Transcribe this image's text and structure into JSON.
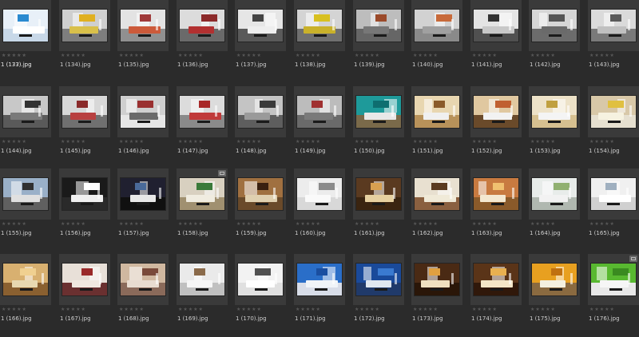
{
  "browser": {
    "rating_glyph": "★★★★★",
    "items": [
      {
        "filename": "1 (133).jpg",
        "palette": {
          "wall": "#d9d9d9",
          "floor": "#8a8a8a",
          "accent": "#4a4a4a",
          "sofa": "#5c5c5c"
        }
      },
      {
        "filename": "1 (134).jpg",
        "palette": {
          "wall": "#cfcfcf",
          "floor": "#7e7e7e",
          "accent": "#e0b020",
          "sofa": "#d9c04a"
        }
      },
      {
        "filename": "1 (135).jpg",
        "palette": {
          "wall": "#e3e3e3",
          "floor": "#909090",
          "accent": "#a03a3a",
          "sofa": "#cc5a3a"
        }
      },
      {
        "filename": "1 (136).jpg",
        "palette": {
          "wall": "#dcdcdc",
          "floor": "#6a6a6a",
          "accent": "#8c2a2a",
          "sofa": "#b23030"
        }
      },
      {
        "filename": "1 (137).jpg",
        "palette": {
          "wall": "#e6e6e6",
          "floor": "#5a5a5a",
          "accent": "#444444",
          "sofa": "#eeeeee"
        }
      },
      {
        "filename": "1 (138).jpg",
        "palette": {
          "wall": "#d4d4d4",
          "floor": "#707070",
          "accent": "#d8c020",
          "sofa": "#c9b12a"
        }
      },
      {
        "filename": "1 (139).jpg",
        "palette": {
          "wall": "#bdbdbd",
          "floor": "#666666",
          "accent": "#9b4a2a",
          "sofa": "#777777"
        }
      },
      {
        "filename": "1 (140).jpg",
        "palette": {
          "wall": "#d2d2d2",
          "floor": "#8a8a8a",
          "accent": "#c86a3a",
          "sofa": "#a0a0a0"
        }
      },
      {
        "filename": "1 (141).jpg",
        "palette": {
          "wall": "#e4e4e4",
          "floor": "#505050",
          "accent": "#333333",
          "sofa": "#c8c8c8"
        }
      },
      {
        "filename": "1 (142).jpg",
        "palette": {
          "wall": "#d6d6d6",
          "floor": "#6c6c6c",
          "accent": "#555555",
          "sofa": "#6a6a6a"
        }
      },
      {
        "filename": "1 (143).jpg",
        "palette": {
          "wall": "#dadada",
          "floor": "#7a7a7a",
          "accent": "#5a5a5a",
          "sofa": "#c0c0c0"
        }
      },
      {
        "filename": "1 (144).jpg",
        "palette": {
          "wall": "#c8c8c8",
          "floor": "#5a5a5a",
          "accent": "#333333",
          "sofa": "#7a7a7a"
        }
      },
      {
        "filename": "1 (145).jpg",
        "palette": {
          "wall": "#d8d8d8",
          "floor": "#707070",
          "accent": "#8a2a2a",
          "sofa": "#b84040"
        }
      },
      {
        "filename": "1 (146).jpg",
        "palette": {
          "wall": "#cfcfcf",
          "floor": "#e6e6e6",
          "accent": "#9a3030",
          "sofa": "#6a6a6a"
        }
      },
      {
        "filename": "1 (147).jpg",
        "palette": {
          "wall": "#dcdcdc",
          "floor": "#8a8a8a",
          "accent": "#a82828",
          "sofa": "#c03a3a"
        }
      },
      {
        "filename": "1 (148).jpg",
        "palette": {
          "wall": "#c4c4c4",
          "floor": "#5e5e5e",
          "accent": "#3a3a3a",
          "sofa": "#9a9a9a"
        }
      },
      {
        "filename": "1 (149).jpg",
        "palette": {
          "wall": "#bcbcbc",
          "floor": "#6a6a6a",
          "accent": "#a03030",
          "sofa": "#7a7a7a"
        }
      },
      {
        "filename": "1 (150).jpg",
        "palette": {
          "wall": "#1e9a9a",
          "floor": "#7a6a4a",
          "accent": "#0e6e70",
          "sofa": "#e8e8e8"
        }
      },
      {
        "filename": "1 (151).jpg",
        "palette": {
          "wall": "#e8d6b0",
          "floor": "#b8925a",
          "accent": "#8a5a2a",
          "sofa": "#f0f0f0"
        }
      },
      {
        "filename": "1 (152).jpg",
        "palette": {
          "wall": "#e0c8a0",
          "floor": "#6a4a2a",
          "accent": "#c06030",
          "sofa": "#f2f2f2"
        }
      },
      {
        "filename": "1 (153).jpg",
        "palette": {
          "wall": "#ede2c8",
          "floor": "#d6c090",
          "accent": "#c0a040",
          "sofa": "#f4f4f4"
        }
      },
      {
        "filename": "1 (154).jpg",
        "palette": {
          "wall": "#d8c8a8",
          "floor": "#e6e0d0",
          "accent": "#e0c040",
          "sofa": "#f6f2e0"
        }
      },
      {
        "filename": "1 (155).jpg",
        "palette": {
          "wall": "#9ab0c8",
          "floor": "#606060",
          "accent": "#303030",
          "sofa": "#e0e0e0"
        }
      },
      {
        "filename": "1 (156).jpg",
        "palette": {
          "wall": "#1a1a1a",
          "floor": "#2a2a2a",
          "accent": "#ffffff",
          "sofa": "#f0f0f0"
        }
      },
      {
        "filename": "1 (157).jpg",
        "palette": {
          "wall": "#202030",
          "floor": "#101010",
          "accent": "#4a6a9a",
          "sofa": "#e8e8e8"
        }
      },
      {
        "filename": "1 (158).jpg",
        "palette": {
          "wall": "#d8d0c0",
          "floor": "#a09070",
          "accent": "#3a7a3a",
          "sofa": "#f0ece0"
        }
      },
      {
        "filename": "1 (159).jpg",
        "palette": {
          "wall": "#a07040",
          "floor": "#6a4a2a",
          "accent": "#3a2010",
          "sofa": "#e0d0b0"
        }
      },
      {
        "filename": "1 (160).jpg",
        "palette": {
          "wall": "#ececec",
          "floor": "#d8d8d8",
          "accent": "#8a8a8a",
          "sofa": "#fafafa"
        }
      },
      {
        "filename": "1 (161).jpg",
        "palette": {
          "wall": "#5a3a20",
          "floor": "#3a2410",
          "accent": "#d8a050",
          "sofa": "#e6d0a0"
        }
      },
      {
        "filename": "1 (162).jpg",
        "palette": {
          "wall": "#e8e0d0",
          "floor": "#8a6040",
          "accent": "#5a3a20",
          "sofa": "#f0ead8"
        }
      },
      {
        "filename": "1 (163).jpg",
        "palette": {
          "wall": "#c87a40",
          "floor": "#8a5a2a",
          "accent": "#f0c070",
          "sofa": "#f4e8d0"
        }
      },
      {
        "filename": "1 (164).jpg",
        "palette": {
          "wall": "#e8ecea",
          "floor": "#b0b8b0",
          "accent": "#90b070",
          "sofa": "#f2f2f2"
        }
      },
      {
        "filename": "1 (165).jpg",
        "palette": {
          "wall": "#f0f0f0",
          "floor": "#d0d0d0",
          "accent": "#a0b0c0",
          "sofa": "#ffffff"
        }
      },
      {
        "filename": "1 (166).jpg",
        "palette": {
          "wall": "#d8b070",
          "floor": "#8a6030",
          "accent": "#f0d090",
          "sofa": "#e8d8b0"
        }
      },
      {
        "filename": "1 (167).jpg",
        "palette": {
          "wall": "#e8e0d8",
          "floor": "#6a3030",
          "accent": "#9a2a2a",
          "sofa": "#f0e8e0"
        }
      },
      {
        "filename": "1 (168).jpg",
        "palette": {
          "wall": "#d0b8a0",
          "floor": "#8a6a5a",
          "accent": "#7a4a3a",
          "sofa": "#e8dcd0"
        }
      },
      {
        "filename": "1 (169).jpg",
        "palette": {
          "wall": "#eaeaea",
          "floor": "#c0c0c0",
          "accent": "#8a6a4a",
          "sofa": "#f6f6f6"
        }
      },
      {
        "filename": "1 (170).jpg",
        "palette": {
          "wall": "#f2f2f2",
          "floor": "#e0e0e0",
          "accent": "#505050",
          "sofa": "#ffffff"
        }
      },
      {
        "filename": "1 (171).jpg",
        "palette": {
          "wall": "#2a6ec8",
          "floor": "#d8dde8",
          "accent": "#1a4ea0",
          "sofa": "#f0f4f8"
        }
      },
      {
        "filename": "1 (172).jpg",
        "palette": {
          "wall": "#1a4a9a",
          "floor": "#203a6a",
          "accent": "#3a7ad0",
          "sofa": "#e0e8f0"
        }
      },
      {
        "filename": "1 (173).jpg",
        "palette": {
          "wall": "#4a2a14",
          "floor": "#2a1608",
          "accent": "#e0a040",
          "sofa": "#f0e0c0"
        }
      },
      {
        "filename": "1 (174).jpg",
        "palette": {
          "wall": "#5a3418",
          "floor": "#30180a",
          "accent": "#e8b050",
          "sofa": "#f4e6c8"
        }
      },
      {
        "filename": "1 (175).jpg",
        "palette": {
          "wall": "#e8a020",
          "floor": "#8a6a40",
          "accent": "#c07010",
          "sofa": "#f4f0e0"
        }
      },
      {
        "filename": "1 (176).jpg",
        "palette": {
          "wall": "#58b830",
          "floor": "#e8e8e8",
          "accent": "#3a8a20",
          "sofa": "#f6f6f6"
        }
      },
      {
        "filename": "1 (177).jpg",
        "palette": {
          "wall": "#e8f0f8",
          "floor": "#c8d8e8",
          "accent": "#2a8ad0",
          "sofa": "#ffffff"
        }
      }
    ]
  }
}
